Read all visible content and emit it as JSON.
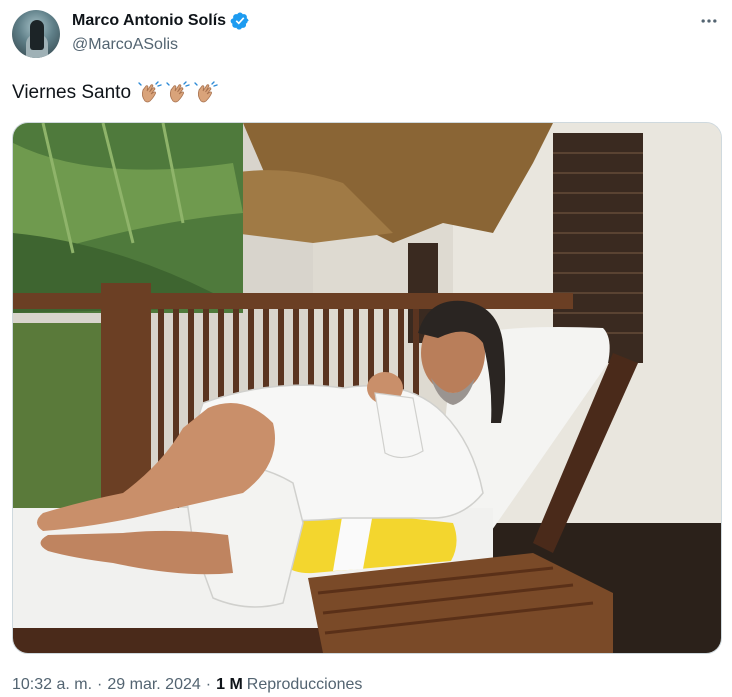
{
  "author": {
    "display_name": "Marco Antonio Solís",
    "handle": "@MarcoASolis",
    "avatar_icon": "avatar-photo",
    "verified_icon": "verified-badge-icon",
    "verified_color": "#1d9bf0"
  },
  "tweet": {
    "text": "Viernes Santo",
    "emoji": [
      "👏🏼",
      "👏🏼",
      "👏🏼"
    ],
    "media_description_icon": "photo-image"
  },
  "meta": {
    "time": "10:32 a. m.",
    "dot1": "·",
    "date": "29 mar. 2024",
    "dot2": "·",
    "views_count": "1 M",
    "views_label": "Reproducciones"
  },
  "colors": {
    "text_primary": "#0f1419",
    "text_secondary": "#536471",
    "border": "#cfd9de"
  }
}
